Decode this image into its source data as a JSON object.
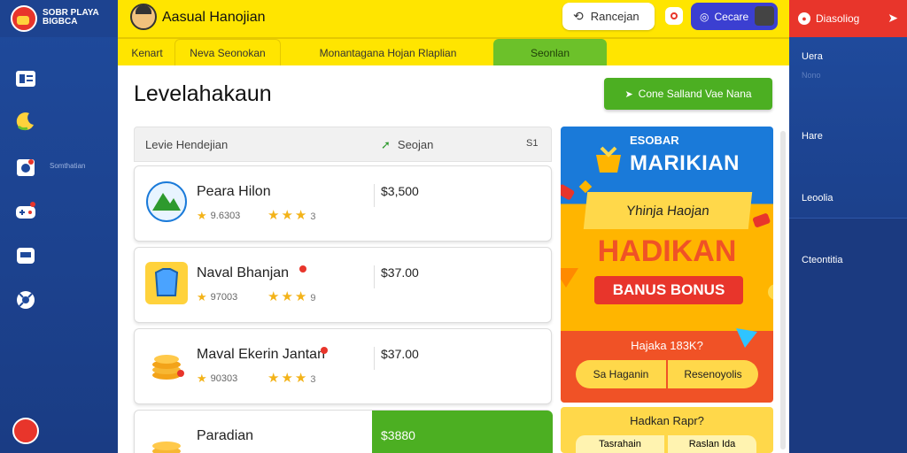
{
  "brand": {
    "text": "SOBR PLAYA BIGBCA"
  },
  "left_sidebar": {
    "label": "Somthatian"
  },
  "topbar": {
    "user_name": "Aasual Hanojian",
    "search_label": "Rancejan",
    "connect_label": "Cecare"
  },
  "right_top": {
    "label": "Diasoliog"
  },
  "tabs": [
    "Kenart",
    "Neva Seonokan",
    "Monantagana Hojan Rlaplian",
    "Seonlan"
  ],
  "main": {
    "title": "Levelahakaun",
    "cta_label": "Cone Salland Vae Nana"
  },
  "list": {
    "header": {
      "col1": "Levie Hendejian",
      "col2": "Seojan",
      "col3": "S1"
    },
    "rows": [
      {
        "name": "Peara Hilon",
        "meta": "9.6303",
        "rating": "3",
        "price": "$3,500"
      },
      {
        "name": "Naval Bhanjan",
        "meta": "97003",
        "rating": "9",
        "price": "$37.00"
      },
      {
        "name": "Maval Ekerin Jantan",
        "meta": "90303",
        "rating": "3",
        "price": "$37.00"
      },
      {
        "name": "Paradian",
        "meta": "",
        "rating": "",
        "price": "$3880"
      }
    ]
  },
  "promo": {
    "title": "ESOBAR",
    "headline": "MARIKIAN",
    "ribbon": "Yhinja Haojan",
    "main": "HADIKAN",
    "bonus": "BANUS BONUS",
    "question": "Hajaka 183K?",
    "btn1": "Sa Haganin",
    "btn2": "Resenoyolis"
  },
  "promo2": {
    "question": "Hadkan Rapr?",
    "btn1": "Tasrahain",
    "btn2": "Raslan Ida"
  },
  "right_panel": {
    "items": [
      "Uera",
      "Hare",
      "Leoolia",
      "Cteontitia"
    ],
    "sub": "Nono"
  },
  "colors": {
    "yellow": "#ffe500",
    "green": "#4caf22",
    "red": "#e8352b",
    "blue": "#1a7ad9",
    "navy": "#1f4a9c"
  }
}
